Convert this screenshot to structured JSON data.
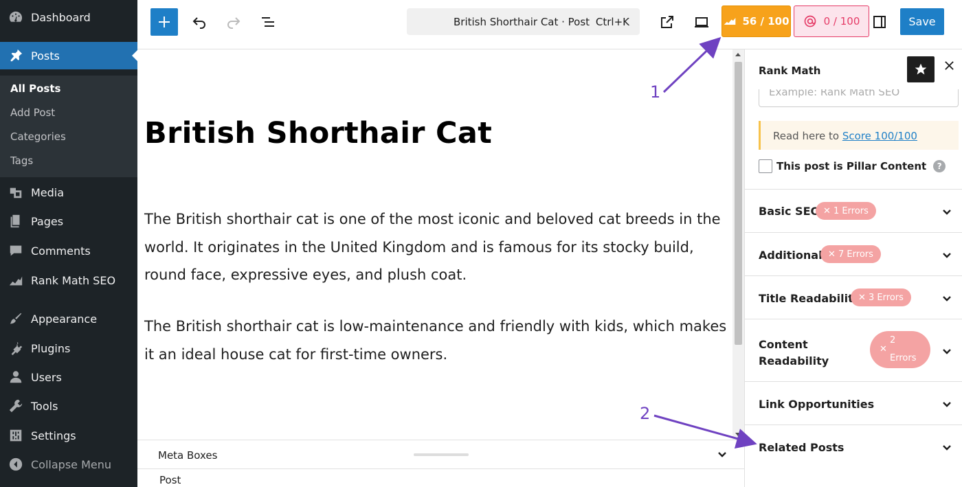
{
  "sidebar": {
    "items": [
      {
        "label": "Dashboard",
        "icon": "dashboard-icon"
      },
      {
        "label": "Posts",
        "icon": "pin-icon"
      },
      {
        "label": "Media",
        "icon": "media-icon"
      },
      {
        "label": "Pages",
        "icon": "pages-icon"
      },
      {
        "label": "Comments",
        "icon": "comments-icon"
      },
      {
        "label": "Rank Math SEO",
        "icon": "rank-math-icon"
      },
      {
        "label": "Appearance",
        "icon": "paintbrush-icon"
      },
      {
        "label": "Plugins",
        "icon": "plugin-icon"
      },
      {
        "label": "Users",
        "icon": "users-icon"
      },
      {
        "label": "Tools",
        "icon": "wrench-icon"
      },
      {
        "label": "Settings",
        "icon": "settings-icon"
      },
      {
        "label": "Collapse Menu",
        "icon": "collapse-icon"
      }
    ],
    "posts_submenu": [
      "All Posts",
      "Add Post",
      "Categories",
      "Tags"
    ]
  },
  "toolbar": {
    "command_title": "British Shorthair Cat · Post",
    "command_shortcut": "Ctrl+K",
    "seo_score": "56 / 100",
    "ai_score": "0 / 100",
    "save_label": "Save"
  },
  "post": {
    "title": "British Shorthair Cat",
    "paragraphs": [
      "The British shorthair cat is one of the most iconic and beloved cat breeds in the world. It originates in the United Kingdom and is famous for its stocky build, round face, expressive eyes, and plush coat.",
      "The British shorthair cat is low-maintenance and friendly with kids, which makes it an ideal house cat for first-time owners."
    ]
  },
  "meta": {
    "label": "Meta Boxes",
    "footer": "Post"
  },
  "panel": {
    "title": "Rank Math",
    "keyword_placeholder": "Example: Rank Math SEO",
    "notice_prefix": "Read here to",
    "notice_link": "Score 100/100",
    "pillar_label": "This post is Pillar Content",
    "sections": [
      {
        "label": "Basic SEO",
        "badge": "1 Errors"
      },
      {
        "label": "Additional",
        "badge": "7 Errors"
      },
      {
        "label": "Title Readability",
        "badge": "3 Errors"
      },
      {
        "label": "Content Readability",
        "badge": "2 Errors"
      },
      {
        "label": "Link Opportunities",
        "badge": ""
      },
      {
        "label": "Related Posts",
        "badge": ""
      }
    ]
  },
  "annotations": [
    "1",
    "2"
  ],
  "colors": {
    "accent": "#2271b1",
    "seo_score": "#f7a21b",
    "ai_score": "#e53a66",
    "error_badge": "#f4a3a3",
    "annotation": "#6f42c1"
  }
}
